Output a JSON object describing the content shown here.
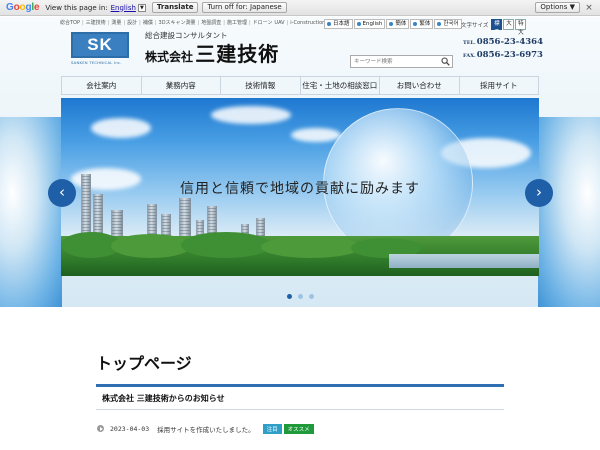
{
  "translate_bar": {
    "logo": [
      "G",
      "o",
      "o",
      "g",
      "l",
      "e"
    ],
    "view_text": "View this page in:",
    "language": "English",
    "translate_button": "Translate",
    "turn_off_button": "Turn off for: Japanese",
    "options_button": "Options ▼",
    "close": "×"
  },
  "top_links": [
    "総合TOP",
    "三建技術",
    "測量",
    "設計",
    "補償",
    "3Dスキャン測量",
    "地盤調査",
    "施工管理",
    "ドローン",
    "UAV",
    "i-Construction"
  ],
  "languages": [
    "日本語",
    "English",
    "簡体",
    "繁体",
    "한국어"
  ],
  "font_size": {
    "label": "文字サイズ",
    "options": [
      "標準",
      "大",
      "特大"
    ]
  },
  "logo": {
    "mark": "SK",
    "sub": "SANKEN TECHNICAL Inc."
  },
  "tagline": "総合建設コンサルタント",
  "company": {
    "prefix": "株式会社",
    "name": "三建技術"
  },
  "search": {
    "placeholder": "キーワード検索"
  },
  "contact": {
    "tel_label": "TEL.",
    "tel": "0856-23-4364",
    "fax_label": "FAX.",
    "fax": "0856-23-6973"
  },
  "main_nav": [
    "会社案内",
    "業務内容",
    "技術情報",
    "住宅・土地の相談窓口",
    "お問い合わせ",
    "採用サイト"
  ],
  "hero": {
    "caption": "信用と信頼で地域の貢献に励みます",
    "prev": "‹",
    "next": "›",
    "slides": 3,
    "active_slide": 1
  },
  "page": {
    "title": "トップページ"
  },
  "news": {
    "heading": "株式会社 三建技術からのお知らせ",
    "items": [
      {
        "date": "2023-04-03",
        "title": "採用サイトを作成いたしました。",
        "tags": [
          {
            "label": "注目",
            "color": "#2f9fc8"
          },
          {
            "label": "オススメ",
            "color": "#1f9a3a"
          }
        ]
      }
    ]
  },
  "colors": {
    "brand_blue": "#1e5fa8",
    "logo_blue": "#3a7fc0",
    "accent_line": "#2f6fb3"
  }
}
